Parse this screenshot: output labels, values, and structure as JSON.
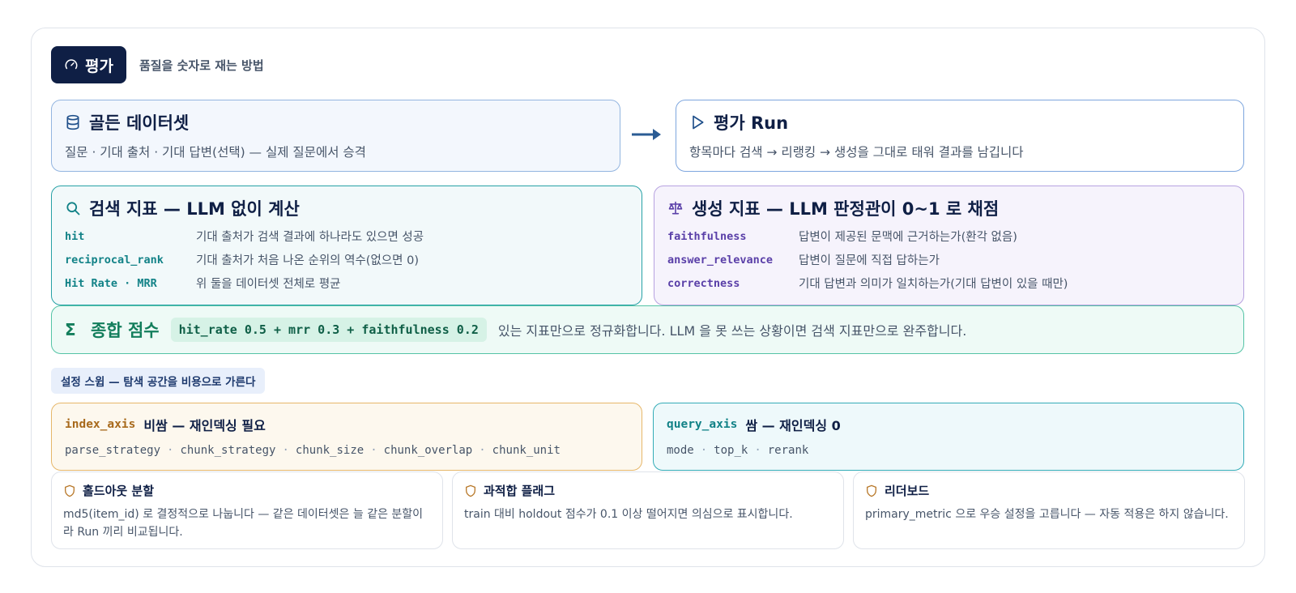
{
  "header": {
    "badge_label": "평가",
    "badge_icon": "gauge-icon",
    "subtitle": "품질을 숫자로 재는 방법"
  },
  "golden_dataset": {
    "icon": "database-icon",
    "title": "골든 데이터셋",
    "desc": "질문 · 기대 출처 · 기대 답변(선택) — 실제 질문에서 승격"
  },
  "eval_run": {
    "icon": "play-icon",
    "title": "평가 Run",
    "desc": "항목마다 검색 → 리랭킹 → 생성을 그대로 태워 결과를 남깁니다"
  },
  "retrieval_metrics": {
    "icon": "search-icon",
    "title": "검색 지표 — LLM 없이 계산",
    "items": [
      {
        "key": "hit",
        "desc": "기대 출처가 검색 결과에 하나라도 있으면 성공"
      },
      {
        "key": "reciprocal_rank",
        "desc": "기대 출처가 처음 나온 순위의 역수(없으면 0)"
      },
      {
        "key": "Hit Rate · MRR",
        "desc": "위 둘을 데이터셋 전체로 평균"
      }
    ]
  },
  "generation_metrics": {
    "icon": "scale-icon",
    "title": "생성 지표 — LLM 판정관이 0~1 로 채점",
    "items": [
      {
        "key": "faithfulness",
        "desc": "답변이 제공된 문맥에 근거하는가(환각 없음)"
      },
      {
        "key": "answer_relevance",
        "desc": "답변이 질문에 직접 답하는가"
      },
      {
        "key": "correctness",
        "desc": "기대 답변과 의미가 일치하는가(기대 답변이 있을 때만)"
      }
    ]
  },
  "composite_score": {
    "icon": "sigma-icon",
    "symbol": "Σ",
    "title": "종합 점수",
    "formula": "hit_rate 0.5 + mrr 0.3 + faithfulness 0.2",
    "desc": "있는 지표만으로 정규화합니다. LLM 을 못 쓰는 상황이면 검색 지표만으로 완주합니다."
  },
  "sweep": {
    "label": "설정 스윕 — 탐색 공간을 비용으로 가른다",
    "index_axis": {
      "key": "index_axis",
      "name": "비쌈 — 재인덱싱 필요",
      "params": [
        "parse_strategy",
        "chunk_strategy",
        "chunk_size",
        "chunk_overlap",
        "chunk_unit"
      ]
    },
    "query_axis": {
      "key": "query_axis",
      "name": "쌈 — 재인덱싱 0",
      "params": [
        "mode",
        "top_k",
        "rerank"
      ]
    }
  },
  "features": [
    {
      "icon": "shield-icon",
      "title": "홀드아웃 분할",
      "desc": "md5(item_id) 로 결정적으로 나눕니다 — 같은 데이터셋은 늘 같은 분할이라 Run 끼리 비교됩니다."
    },
    {
      "icon": "shield-icon",
      "title": "과적합 플래그",
      "desc": "train 대비 holdout 점수가 0.1 이상 떨어지면 의심으로 표시합니다."
    },
    {
      "icon": "shield-icon",
      "title": "리더보드",
      "desc": "primary_metric 으로 우승 설정을 고릅니다 — 자동 적용은 하지 않습니다."
    }
  ],
  "colors": {
    "navy": "#0f1f45",
    "teal": "#128287",
    "purple": "#5a3fa8",
    "green": "#137e5c",
    "amber": "#a86a1c",
    "blue_arrow": "#2b5c94"
  }
}
